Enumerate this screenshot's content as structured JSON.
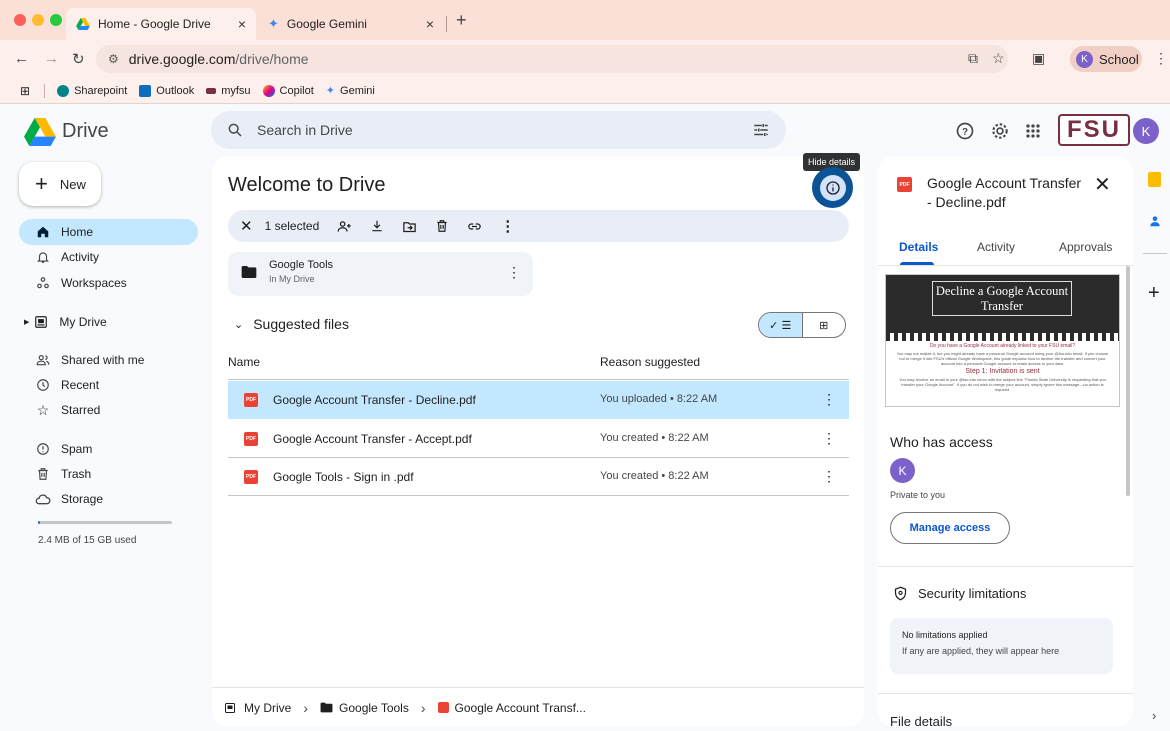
{
  "browser": {
    "tabs": [
      {
        "title": "Home - Google Drive",
        "close": "×"
      },
      {
        "title": "Google Gemini",
        "close": "×"
      }
    ],
    "new_tab": "+",
    "url_host": "drive.google.com",
    "url_path": "/drive/home",
    "profile": {
      "initial": "K",
      "name": "School"
    },
    "bookmarks": [
      "Sharepoint",
      "Outlook",
      "myfsu",
      "Copilot",
      "Gemini"
    ]
  },
  "header": {
    "app_name": "Drive",
    "search_placeholder": "Search in Drive",
    "org_logo": "FSU",
    "avatar_initial": "K"
  },
  "sidebar": {
    "new_label": "New",
    "items": [
      {
        "label": "Home",
        "icon": "home-icon"
      },
      {
        "label": "Activity",
        "icon": "bell-icon"
      },
      {
        "label": "Workspaces",
        "icon": "workspaces-icon"
      },
      {
        "label": "My Drive",
        "icon": "my-drive-icon"
      },
      {
        "label": "Shared with me",
        "icon": "people-icon"
      },
      {
        "label": "Recent",
        "icon": "clock-icon"
      },
      {
        "label": "Starred",
        "icon": "star-icon"
      },
      {
        "label": "Spam",
        "icon": "spam-icon"
      },
      {
        "label": "Trash",
        "icon": "trash-icon"
      },
      {
        "label": "Storage",
        "icon": "cloud-icon"
      }
    ],
    "storage_text": "2.4 MB of 15 GB used",
    "storage_fraction": 0.0002
  },
  "main": {
    "title": "Welcome to Drive",
    "selection_text": "1 selected",
    "folder": {
      "name": "Google Tools",
      "location": "In My Drive"
    },
    "suggested_label": "Suggested files",
    "columns": {
      "name": "Name",
      "reason": "Reason suggested"
    },
    "files": [
      {
        "name": "Google Account Transfer - Decline.pdf",
        "reason": "You uploaded • 8:22 AM",
        "selected": true
      },
      {
        "name": "Google Account Transfer - Accept.pdf",
        "reason": "You created • 8:22 AM",
        "selected": false
      },
      {
        "name": "Google Tools - Sign in .pdf",
        "reason": "You created • 8:22 AM",
        "selected": false
      }
    ],
    "breadcrumb": [
      "My Drive",
      "Google Tools",
      "Google Account Transf..."
    ],
    "hide_details_tooltip": "Hide details"
  },
  "details": {
    "file_title": "Google Account Transfer - Decline.pdf",
    "tabs": [
      "Details",
      "Activity",
      "Approvals"
    ],
    "preview": {
      "title": "Decline a Google Account Transfer",
      "question": "Do you have a Google Account already linked to your FSU email?",
      "body": "You may not realize it, but you might already have a personal Google account using your @fsu.edu email. If you choose not to merge it into FSU's official Google Workspace, this guide explains how to decline the transfer and convert your account into a personal Google account to retain access to your data.",
      "step": "Step 1: Invitation is sent",
      "step_body": "You may receive an email in your @fsu.edu inbox with the subject line \"Florida State University is requesting that you transfer your Google Account\". If you do not wish to merge your account, simply ignore this message—no action is required."
    },
    "who_has_access": "Who has access",
    "owner_initial": "K",
    "privacy": "Private to you",
    "manage_access": "Manage access",
    "security_title": "Security limitations",
    "security_status": "No limitations applied",
    "security_note": "If any are applied, they will appear here",
    "file_details": "File details"
  }
}
